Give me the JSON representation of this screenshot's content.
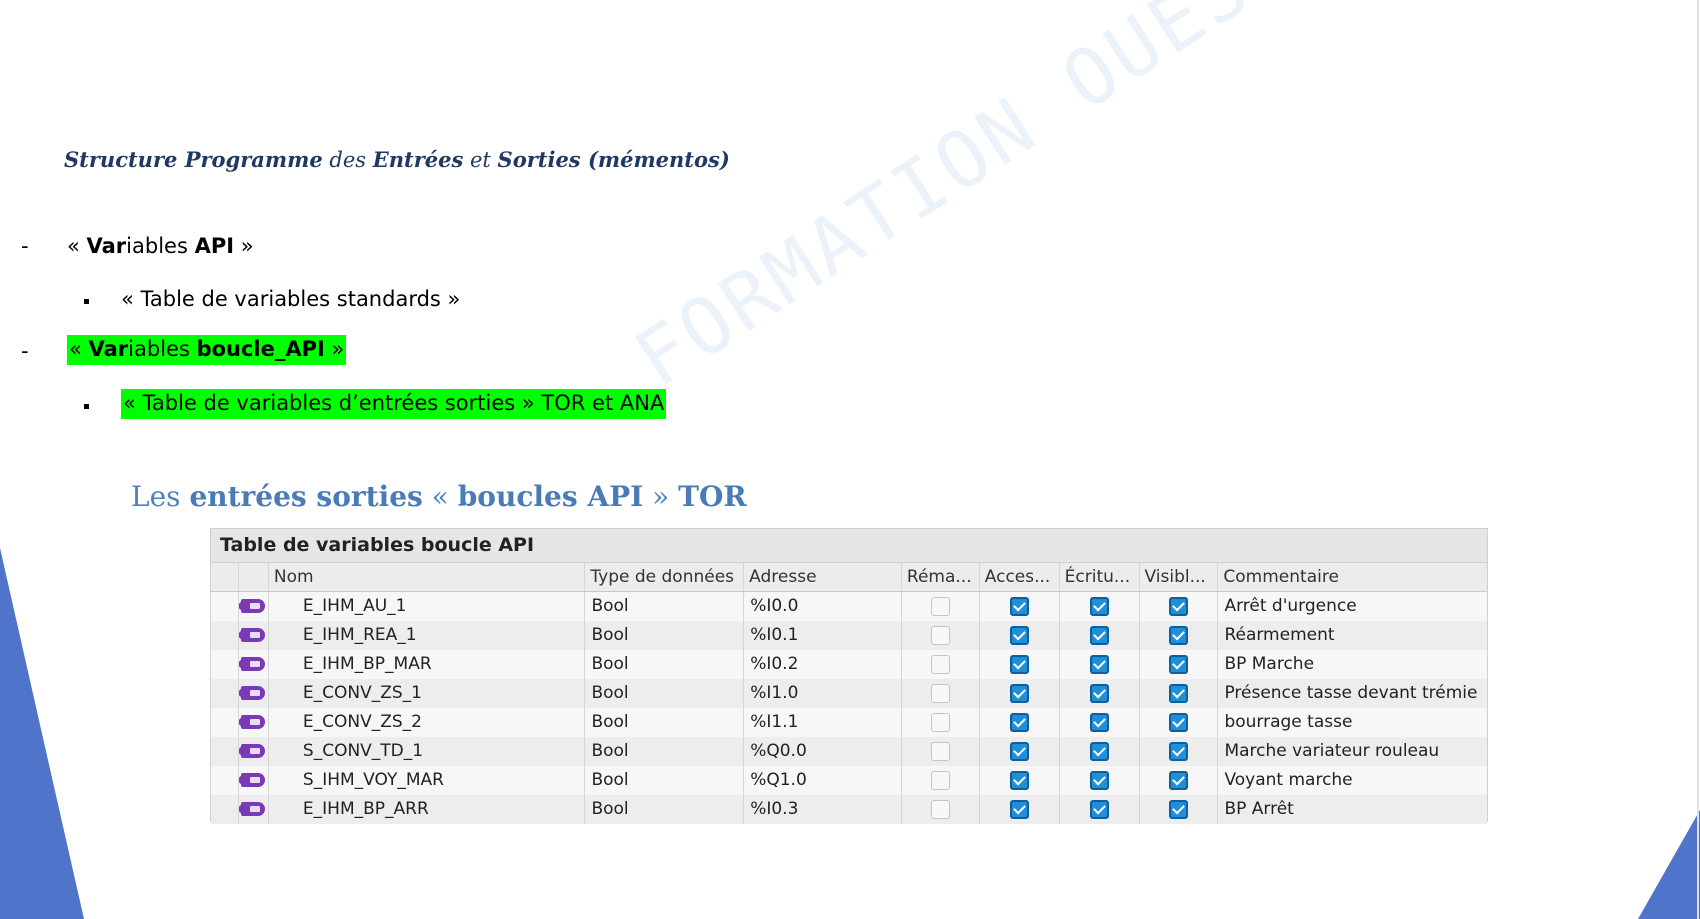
{
  "heading": {
    "p1": "Structure Programme",
    "p2": " des ",
    "p3": "Entrées",
    "p4": " et ",
    "p5": "Sorties (mémentos)"
  },
  "list": [
    {
      "dash": "-",
      "open": "« ",
      "b1": "Var",
      "t1": "iables ",
      "b2": "API",
      "close": " »"
    },
    {
      "text": "« Table de variables standards »"
    },
    {
      "dash": "-",
      "open": "« ",
      "b1": "Var",
      "t1": "iables ",
      "b2": "boucle_API",
      "close": " »"
    },
    {
      "text": "« Table de variables d’entrées sorties » TOR et ANA"
    }
  ],
  "section_title": {
    "a": "Les ",
    "b": "entrées sorties",
    "c": " « ",
    "d": "boucles API",
    "e": " » ",
    "f": "TOR"
  },
  "watermark": "FORMATION OUEST",
  "table": {
    "title": "Table de variables boucle API",
    "columns": [
      "Nom",
      "Type de données",
      "Adresse",
      "Réma...",
      "Acces...",
      "Écritu...",
      "Visibl...",
      "Commentaire"
    ],
    "rows": [
      {
        "name": "E_IHM_AU_1",
        "type": "Bool",
        "address": "%I0.0",
        "retain": false,
        "access": true,
        "write": true,
        "visible": true,
        "comment": "Arrêt d'urgence"
      },
      {
        "name": "E_IHM_REA_1",
        "type": "Bool",
        "address": "%I0.1",
        "retain": false,
        "access": true,
        "write": true,
        "visible": true,
        "comment": "Réarmement"
      },
      {
        "name": "E_IHM_BP_MAR",
        "type": "Bool",
        "address": "%I0.2",
        "retain": false,
        "access": true,
        "write": true,
        "visible": true,
        "comment": "BP Marche"
      },
      {
        "name": "E_CONV_ZS_1",
        "type": "Bool",
        "address": "%I1.0",
        "retain": false,
        "access": true,
        "write": true,
        "visible": true,
        "comment": "Présence tasse devant trémie"
      },
      {
        "name": "E_CONV_ZS_2",
        "type": "Bool",
        "address": "%I1.1",
        "retain": false,
        "access": true,
        "write": true,
        "visible": true,
        "comment": "bourrage tasse"
      },
      {
        "name": "S_CONV_TD_1",
        "type": "Bool",
        "address": "%Q0.0",
        "retain": false,
        "access": true,
        "write": true,
        "visible": true,
        "comment": "Marche variateur rouleau"
      },
      {
        "name": "S_IHM_VOY_MAR",
        "type": "Bool",
        "address": "%Q1.0",
        "retain": false,
        "access": true,
        "write": true,
        "visible": true,
        "comment": "Voyant marche"
      },
      {
        "name": "E_IHM_BP_ARR",
        "type": "Bool",
        "address": "%I0.3",
        "retain": false,
        "access": true,
        "write": true,
        "visible": true,
        "comment": "BP Arrêt"
      }
    ]
  },
  "colors": {
    "highlight": "#00ff00",
    "title_blue": "#4f81bd",
    "heading_navy": "#1f3864",
    "tag_icon": "#7a3ab5",
    "checkbox": "#1f8fd8"
  },
  "icons": {
    "variable": "tag-variable-icon"
  }
}
